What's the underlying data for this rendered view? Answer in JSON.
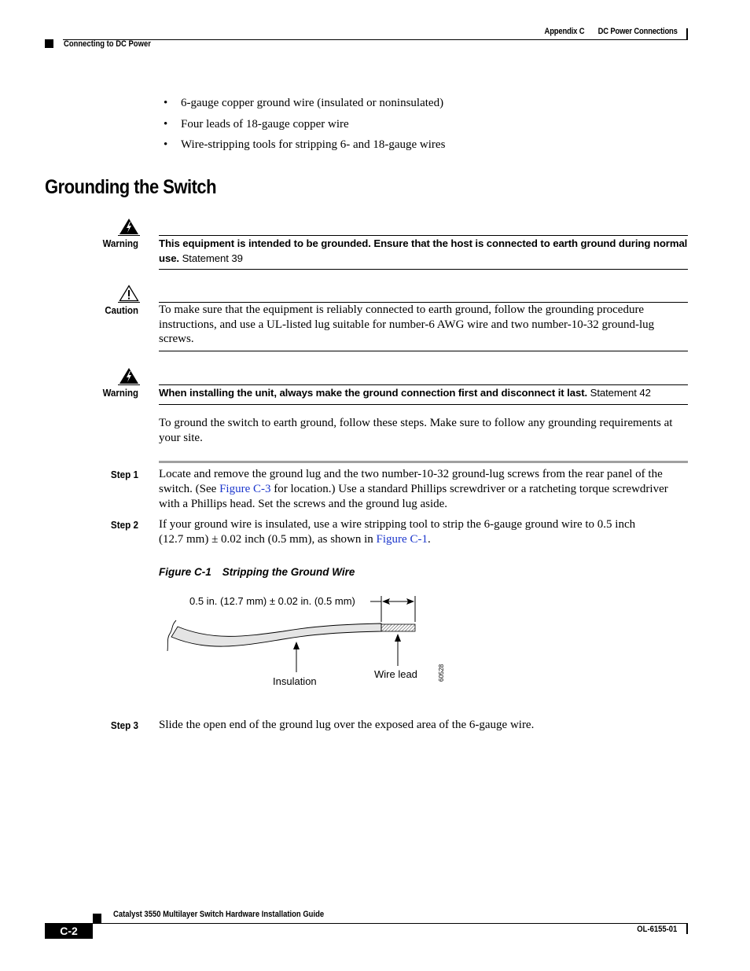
{
  "header": {
    "appendix": "Appendix C",
    "chapter": "DC Power Connections",
    "section": "Connecting to DC Power"
  },
  "bullets": [
    "6-gauge copper ground wire (insulated or noninsulated)",
    "Four leads of 18-gauge copper wire",
    "Wire-stripping tools for stripping 6- and 18-gauge wires"
  ],
  "bullet_glyph": "•",
  "heading": "Grounding the Switch",
  "notices": [
    {
      "type": "warning",
      "icon": "warning-lightning-icon",
      "label": "Warning",
      "text": "This equipment is intended to be grounded. Ensure that the host is connected to earth ground during normal use.",
      "statement": "Statement 39"
    },
    {
      "type": "caution",
      "icon": "caution-exclamation-icon",
      "label": "Caution",
      "text": "To make sure that the equipment is reliably connected to earth ground, follow the grounding procedure instructions, and use a UL-listed lug suitable for number-6 AWG wire and two number-10-32 ground-lug screws."
    },
    {
      "type": "warning",
      "icon": "warning-lightning-icon",
      "label": "Warning",
      "text": "When installing the unit, always make the ground connection first and disconnect it last.",
      "statement": "Statement 42"
    }
  ],
  "intro": "To ground the switch to earth ground, follow these steps. Make sure to follow any grounding requirements at your site.",
  "steps": [
    {
      "label": "Step 1",
      "text_before": "Locate and remove the ground lug and the two number-10-32 ground-lug screws from the rear panel of the switch. (See ",
      "link": "Figure C-3",
      "text_after": " for location.) Use a standard Phillips screwdriver or a ratcheting torque screwdriver with a Phillips head. Set the screws and the ground lug aside."
    },
    {
      "label": "Step 2",
      "text_before": "If your ground wire is insulated, use a wire stripping tool to strip the 6-gauge ground wire to 0.5 inch (12.7 mm) ± 0.02 inch (0.5 mm), as shown in ",
      "link": "Figure C-1",
      "text_after": "."
    },
    {
      "label": "Step 3",
      "text_before": "Slide the open end of the ground lug over the exposed area of the 6-gauge wire.",
      "link": "",
      "text_after": ""
    }
  ],
  "figure": {
    "number": "Figure C-1",
    "title": "Stripping the Ground Wire",
    "dimension_label": "0.5 in. (12.7 mm) ± 0.02 in. (0.5 mm)",
    "insulation_label": "Insulation",
    "lead_label": "Wire lead",
    "art_id": "60528"
  },
  "footer": {
    "guide_title": "Catalyst 3550 Multilayer Switch Hardware Installation Guide",
    "page": "C-2",
    "doc_number": "OL-6155-01"
  },
  "colors": {
    "link": "#1a35cc",
    "step_rule": "#a0a0a0"
  }
}
